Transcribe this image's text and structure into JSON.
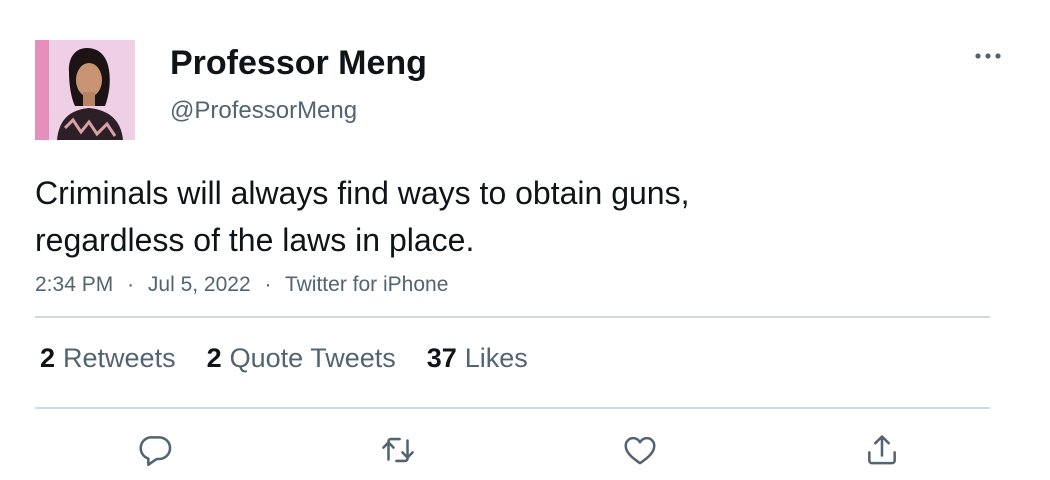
{
  "author": {
    "display_name": "Professor Meng",
    "handle": "@ProfessorMeng"
  },
  "tweet": {
    "text_lines": [
      "Criminals will always find ways to obtain guns,",
      "regardless of the laws in place."
    ],
    "time": "2:34 PM",
    "separator": "·",
    "date": "Jul 5, 2022",
    "source": "Twitter for iPhone"
  },
  "stats": {
    "retweets": {
      "count": "2",
      "label": "Retweets"
    },
    "quote_tweets": {
      "count": "2",
      "label": "Quote Tweets"
    },
    "likes": {
      "count": "37",
      "label": "Likes"
    }
  },
  "icons": {
    "more": "more-horizontal-icon",
    "reply": "reply-bubble-icon",
    "retweet": "retweet-arrows-icon",
    "like": "heart-icon",
    "share": "share-upload-icon"
  },
  "colors": {
    "primary_text": "#0f1419",
    "secondary_text": "#536471",
    "divider": "#cfd9de",
    "background": "#ffffff"
  }
}
